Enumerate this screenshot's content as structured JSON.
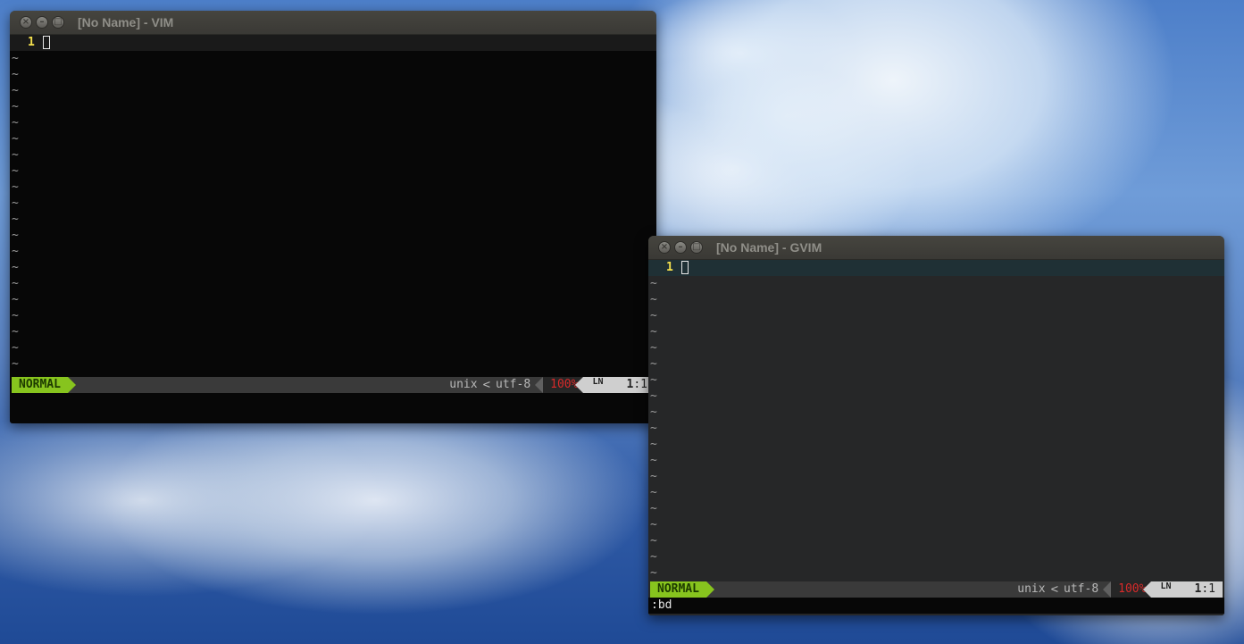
{
  "vim_window": {
    "title": "[No Name] - VIM",
    "line_number": "1",
    "tilde": "~",
    "statusline": {
      "mode": "NORMAL",
      "fileformat": "unix",
      "separator": "<",
      "encoding": "utf-8",
      "percent": "100%",
      "ln_icon": "LN",
      "line": "1",
      "col": "1"
    }
  },
  "gvim_window": {
    "title": "[No Name] - GVIM",
    "line_number": "1",
    "tilde": "~",
    "statusline": {
      "mode": "NORMAL",
      "fileformat": "unix",
      "separator": "<",
      "encoding": "utf-8",
      "percent": "100%",
      "ln_icon": "LN",
      "line": "1",
      "col": "1"
    },
    "command_line": ":bd"
  },
  "window_buttons": {
    "close": "×",
    "minimize": "–",
    "maximize": "□"
  },
  "colors": {
    "mode_bg": "#87c41e",
    "line_number": "#f4e04d",
    "percent": "#d92a2a",
    "vim_bg": "#070707",
    "gvim_bg": "#262728",
    "gvim_cursorline": "#1f3035"
  }
}
